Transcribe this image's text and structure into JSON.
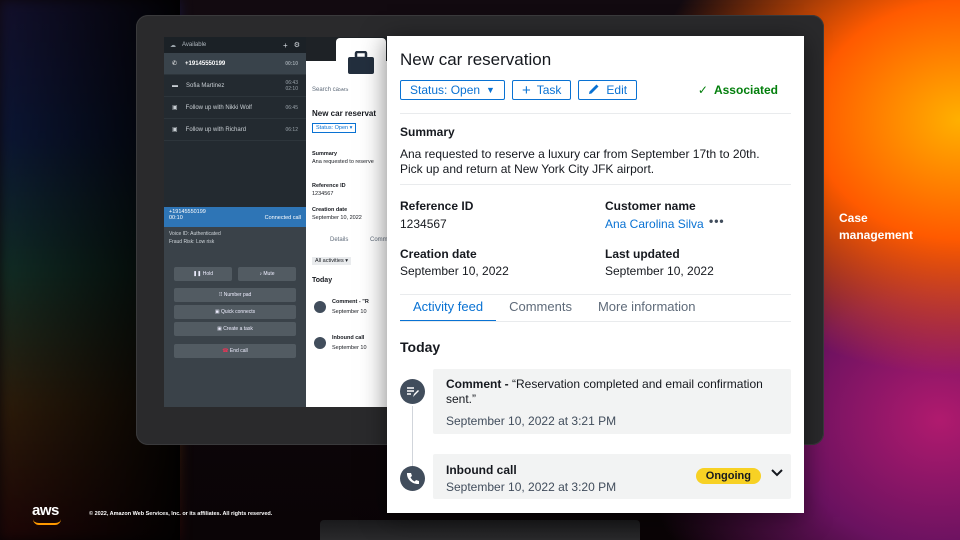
{
  "ccp": {
    "status": "Available",
    "contacts": [
      {
        "name": "+19145550199",
        "time": "00:10"
      },
      {
        "name": "Sofia Martinez",
        "time": "06:43\n02:10"
      },
      {
        "name": "Follow up with Nikki Wolf",
        "time": "06:45"
      },
      {
        "name": "Follow up with Richard",
        "time": "06:12"
      }
    ],
    "call": {
      "number": "+19145550199",
      "duration": "00:10",
      "state": "Connected call",
      "voice_id_label": "Voice ID:",
      "voice_id": "Authenticated",
      "fraud_label": "Fraud Risk:",
      "fraud": "Low risk",
      "hold": "Hold",
      "mute": "Mute",
      "number_pad": "Number pad",
      "quick_connects": "Quick connects",
      "create_task": "Create a task",
      "end_call": "End call"
    }
  },
  "mid": {
    "search": "Search cases",
    "title": "New car reservat",
    "status": "Status: Open",
    "summary_label": "Summary",
    "summary": "Ana requested to reserve",
    "ref_label": "Reference ID",
    "ref": "1234567",
    "created_label": "Creation date",
    "created": "September 10, 2022",
    "tab_details": "Details",
    "tab_comments": "Comm",
    "filter": "All activities",
    "today": "Today",
    "comment": "Comment - \"R",
    "comment_date": "September 10",
    "inbound": "Inbound call",
    "inbound_date": "September 10"
  },
  "card": {
    "title": "New car reservation",
    "status_button": "Status: Open",
    "task_button": "Task",
    "edit_button": "Edit",
    "associated": "Associated",
    "summary_label": "Summary",
    "summary": "Ana requested to reserve a luxury car from September 17th to 20th. Pick up and return at New York City JFK airport.",
    "reference_label": "Reference ID",
    "reference": "1234567",
    "customer_label": "Customer name",
    "customer": "Ana Carolina Silva",
    "creation_label": "Creation date",
    "creation": "September 10, 2022",
    "updated_label": "Last updated",
    "updated": "September 10, 2022",
    "tabs": [
      "Activity feed",
      "Comments",
      "More information"
    ],
    "today": "Today",
    "activity1_prefix": "Comment - ",
    "activity1_text": "“Reservation completed and email confirmation sent.”",
    "activity1_date": "September 10, 2022 at 3:21 PM",
    "activity2_title": "Inbound call",
    "activity2_date": "September 10, 2022 at 3:20 PM",
    "activity2_badge": "Ongoing"
  },
  "side": {
    "line1": "Case",
    "line2": "management"
  },
  "footer": {
    "logo": "aws",
    "copyright": "© 2022, Amazon Web Services, Inc. or its affiliates. All rights reserved."
  },
  "colors": {
    "accent": "#0972d3",
    "success": "#037f0c",
    "badge": "#f7d124",
    "brand_orange": "#ff9900"
  }
}
